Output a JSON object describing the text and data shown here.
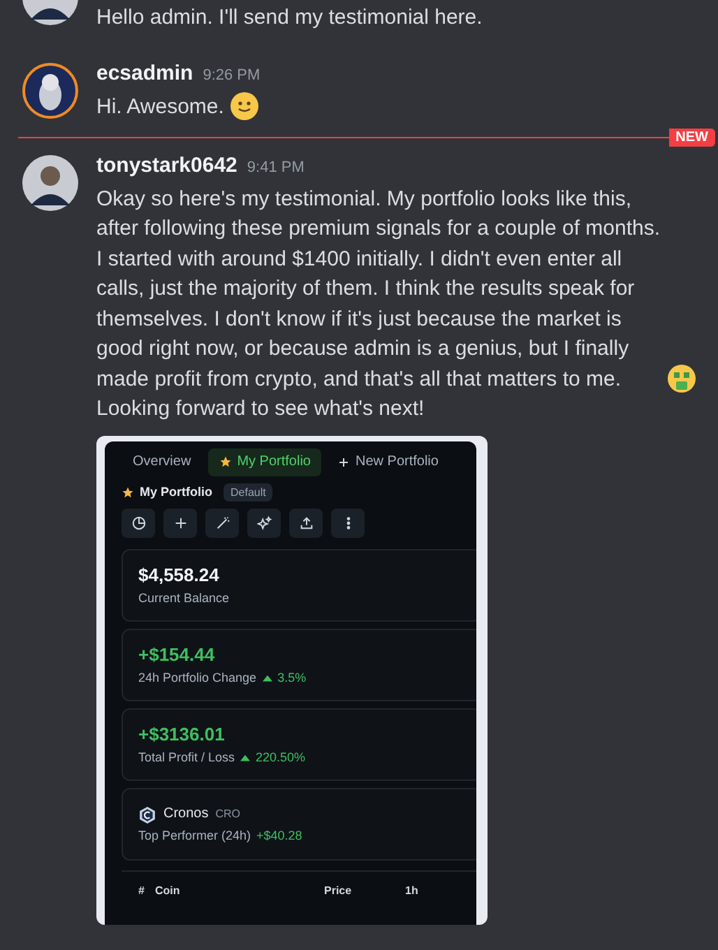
{
  "messages": [
    {
      "kind": "continuation",
      "text": "Hello admin. I'll send my testimonial here."
    },
    {
      "kind": "full",
      "author": "ecsadmin",
      "time": "9:26 PM",
      "text": "Hi. Awesome.",
      "emoji": true
    },
    {
      "kind": "divider",
      "label": "NEW"
    },
    {
      "kind": "full",
      "author": "tonystark0642",
      "time": "9:41 PM",
      "text": "Okay so here's my testimonial. My portfolio looks like this, after following these premium signals for a couple of months. I started with around $1400 initially. I didn't even enter all calls, just the majority of them. I think the results speak for themselves. I don't know if it's just because the market is good right now, or because admin is a genius, but I finally made profit from crypto, and that's all that matters to me.",
      "emoji": true,
      "text_after": "Looking forward to see what's next!",
      "attachment": {
        "tabs": [
          {
            "label": "Overview",
            "selected": false
          },
          {
            "label": "My Portfolio",
            "selected": true
          },
          {
            "label": "New Portfolio",
            "selected": false
          }
        ],
        "title": "My Portfolio",
        "badge": "Default",
        "cards": [
          {
            "kind": "stat",
            "value": "$4,558.24",
            "label": "Current Balance",
            "positive": false
          },
          {
            "kind": "stat",
            "value": "+$154.44",
            "label": "24h Portfolio Change",
            "change": "3.5%",
            "positive": true
          },
          {
            "kind": "stat",
            "value": "+$3136.01",
            "label": "Total Profit / Loss",
            "change": "220.50%",
            "positive": true
          },
          {
            "kind": "performer",
            "coin": "Cronos",
            "symbol": "CRO",
            "label": "Top Performer (24h)",
            "change": "+$40.28",
            "positive": true
          }
        ],
        "columns": [
          "#",
          "Coin",
          "Price",
          "1h"
        ]
      }
    }
  ]
}
